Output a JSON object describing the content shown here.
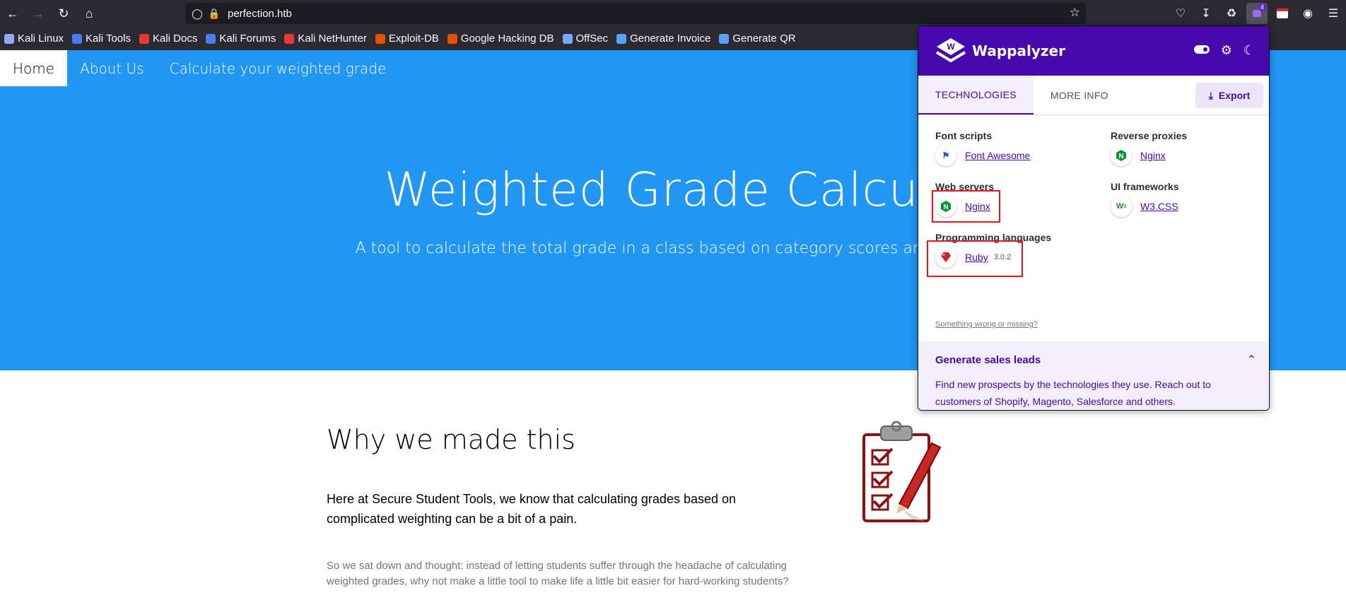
{
  "browser": {
    "url": "perfection.htb",
    "bookmarks": [
      {
        "label": "Kali Linux",
        "color": "#9aa4ff"
      },
      {
        "label": "Kali Tools",
        "color": "#4b7bec"
      },
      {
        "label": "Kali Docs",
        "color": "#e53935"
      },
      {
        "label": "Kali Forums",
        "color": "#4b7bec"
      },
      {
        "label": "Kali NetHunter",
        "color": "#e53935"
      },
      {
        "label": "Exploit-DB",
        "color": "#e65100"
      },
      {
        "label": "Google Hacking DB",
        "color": "#e65100"
      },
      {
        "label": "OffSec",
        "color": "#7aa6ff"
      },
      {
        "label": "Generate Invoice",
        "color": "#5aa0ff"
      },
      {
        "label": "Generate QR",
        "color": "#5aa0ff"
      }
    ],
    "extension_badge": "4"
  },
  "site": {
    "nav": [
      "Home",
      "About Us",
      "Calculate your weighted grade"
    ],
    "hero_title": "Weighted Grade Calcula",
    "hero_subtitle": "A tool to calculate the total grade in a class based on category scores and percen",
    "section_title": "Why we made this",
    "paragraph1": "Here at Secure Student Tools, we know that calculating grades based on complicated weighting can be a bit of a pain.",
    "paragraph2": "So we sat down and thought: instead of letting students suffer through the headache of calculating weighted grades, why not make a little tool to make life a little bit easier for hard-working students?"
  },
  "wappalyzer": {
    "title": "Wappalyzer",
    "tabs": [
      "TECHNOLOGIES",
      "MORE INFO"
    ],
    "export_label": "Export",
    "categories": [
      {
        "name": "Font scripts",
        "tech": "Font Awesome",
        "version": ""
      },
      {
        "name": "Reverse proxies",
        "tech": "Nginx",
        "version": ""
      },
      {
        "name": "Web servers",
        "tech": "Nginx",
        "version": ""
      },
      {
        "name": "UI frameworks",
        "tech": "W3.CSS",
        "version": ""
      },
      {
        "name": "Programming languages",
        "tech": "Ruby",
        "version": "3.0.2"
      }
    ],
    "something_wrong": "Something wrong or missing?",
    "leads_title": "Generate sales leads",
    "leads_text": "Find new prospects by the technologies they use. Reach out to customers of Shopify, Magento, Salesforce and others."
  },
  "colors": {
    "site_blue": "#2196f3",
    "wappalyzer_purple": "#4608ad",
    "highlight_red": "#e8141f"
  }
}
